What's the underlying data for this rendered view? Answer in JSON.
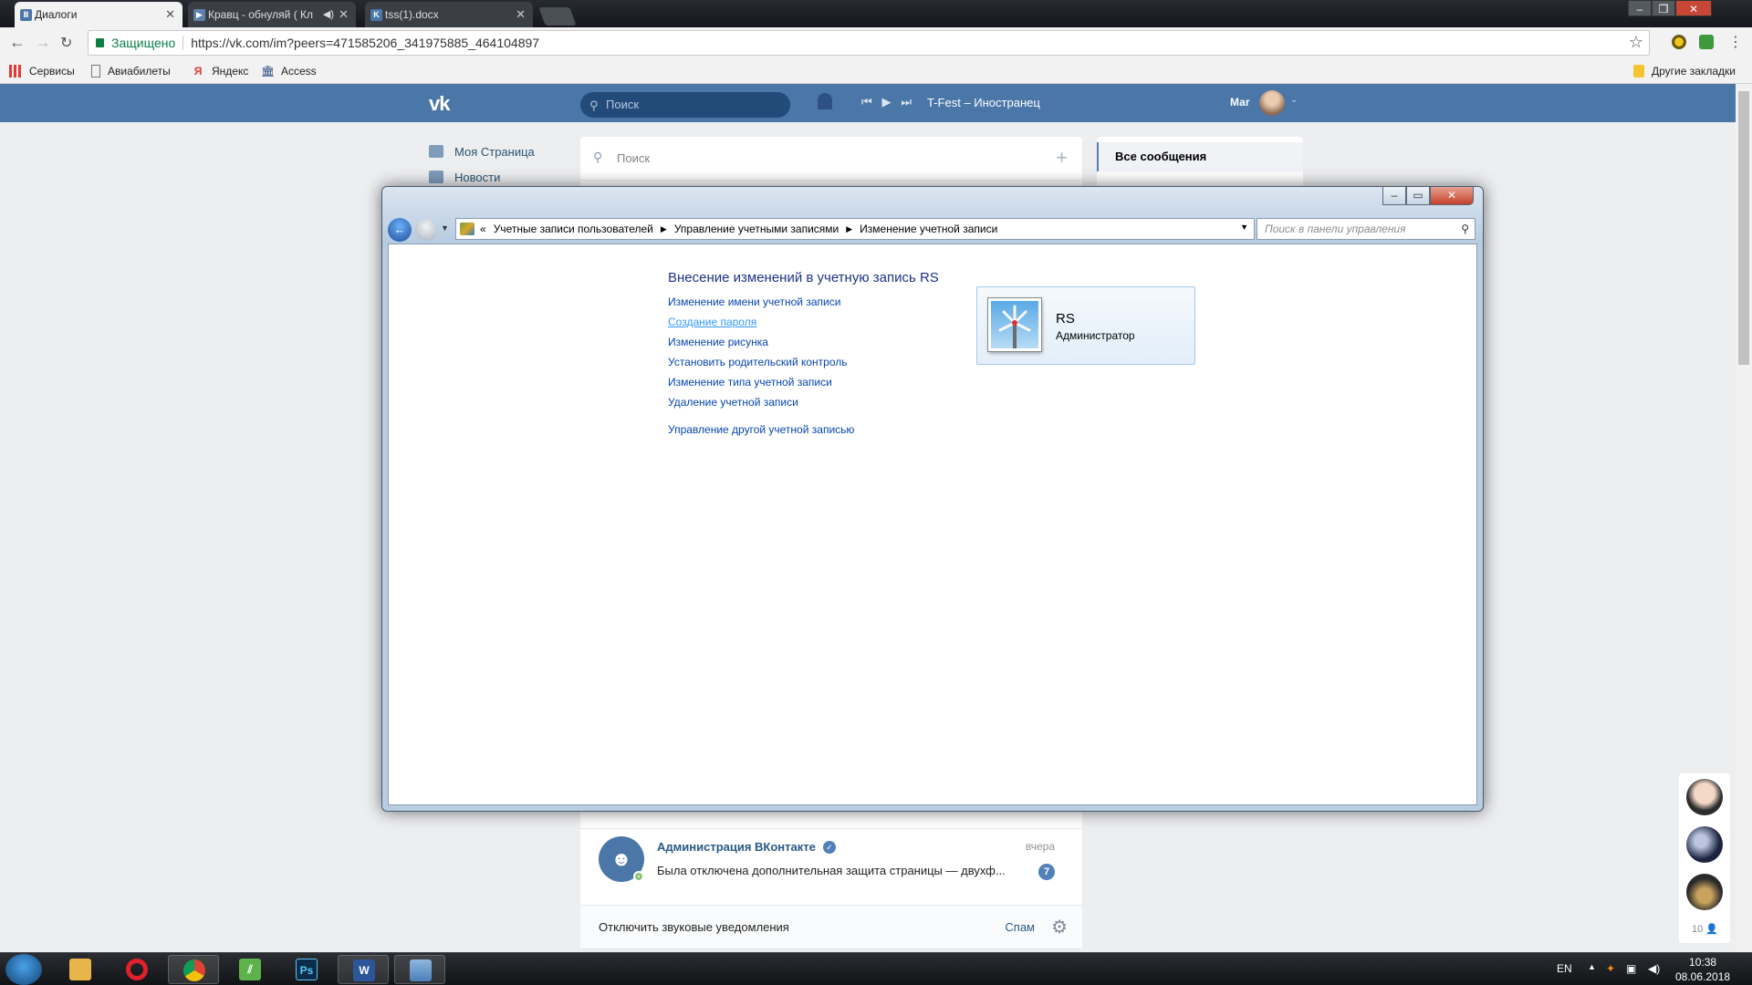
{
  "browser": {
    "tabs": [
      {
        "title": "Диалоги",
        "active": true
      },
      {
        "title": "Кравц - обнуляй ( Кл",
        "active": false
      },
      {
        "title": "tss(1).docx",
        "active": false
      }
    ],
    "security_label": "Защищено",
    "url": "https://vk.com/im?peers=471585206_341975885_464104897",
    "bookmarks": [
      "Сервисы",
      "Авиабилеты",
      "Яндекс",
      "Access"
    ],
    "other_bookmarks": "Другие закладки",
    "window_controls": [
      "–",
      "❐",
      "✕"
    ]
  },
  "vk": {
    "logo": "vk",
    "search_placeholder": "Поиск",
    "now_playing": "T-Fest – Иностранец",
    "user_name": "Маr",
    "left_menu": [
      "Моя Страница",
      "Новости"
    ],
    "dialogs_search_placeholder": "Поиск",
    "dialog": {
      "avatar_letter": "☻",
      "name": "Администрация ВКонтакте",
      "message": "Была отключена дополнительная защита страницы — двухф...",
      "time": "вчера",
      "unread": "7"
    },
    "footer_mute": "Отключить звуковые уведомления",
    "footer_spam": "Спам",
    "right_all_messages": "Все сообщения",
    "friends_online_count": "10"
  },
  "control_panel": {
    "breadcrumb": [
      "Учетные записи пользователей",
      "Управление учетными записями",
      "Изменение учетной записи"
    ],
    "search_placeholder": "Поиск в панели управления",
    "heading": "Внесение изменений в учетную запись RS",
    "links": [
      "Изменение имени учетной записи",
      "Создание пароля",
      "Изменение рисунка",
      "Установить родительский контроль",
      "Изменение типа учетной записи",
      "Удаление учетной записи"
    ],
    "other_link": "Управление другой учетной записью",
    "account": {
      "name": "RS",
      "role": "Администратор"
    }
  },
  "taskbar": {
    "language": "EN",
    "time": "10:38",
    "date": "08.06.2018"
  },
  "colors": {
    "vk_blue": "#4a76a8",
    "link_blue": "#0645ad",
    "heading_blue": "#1e3287"
  }
}
